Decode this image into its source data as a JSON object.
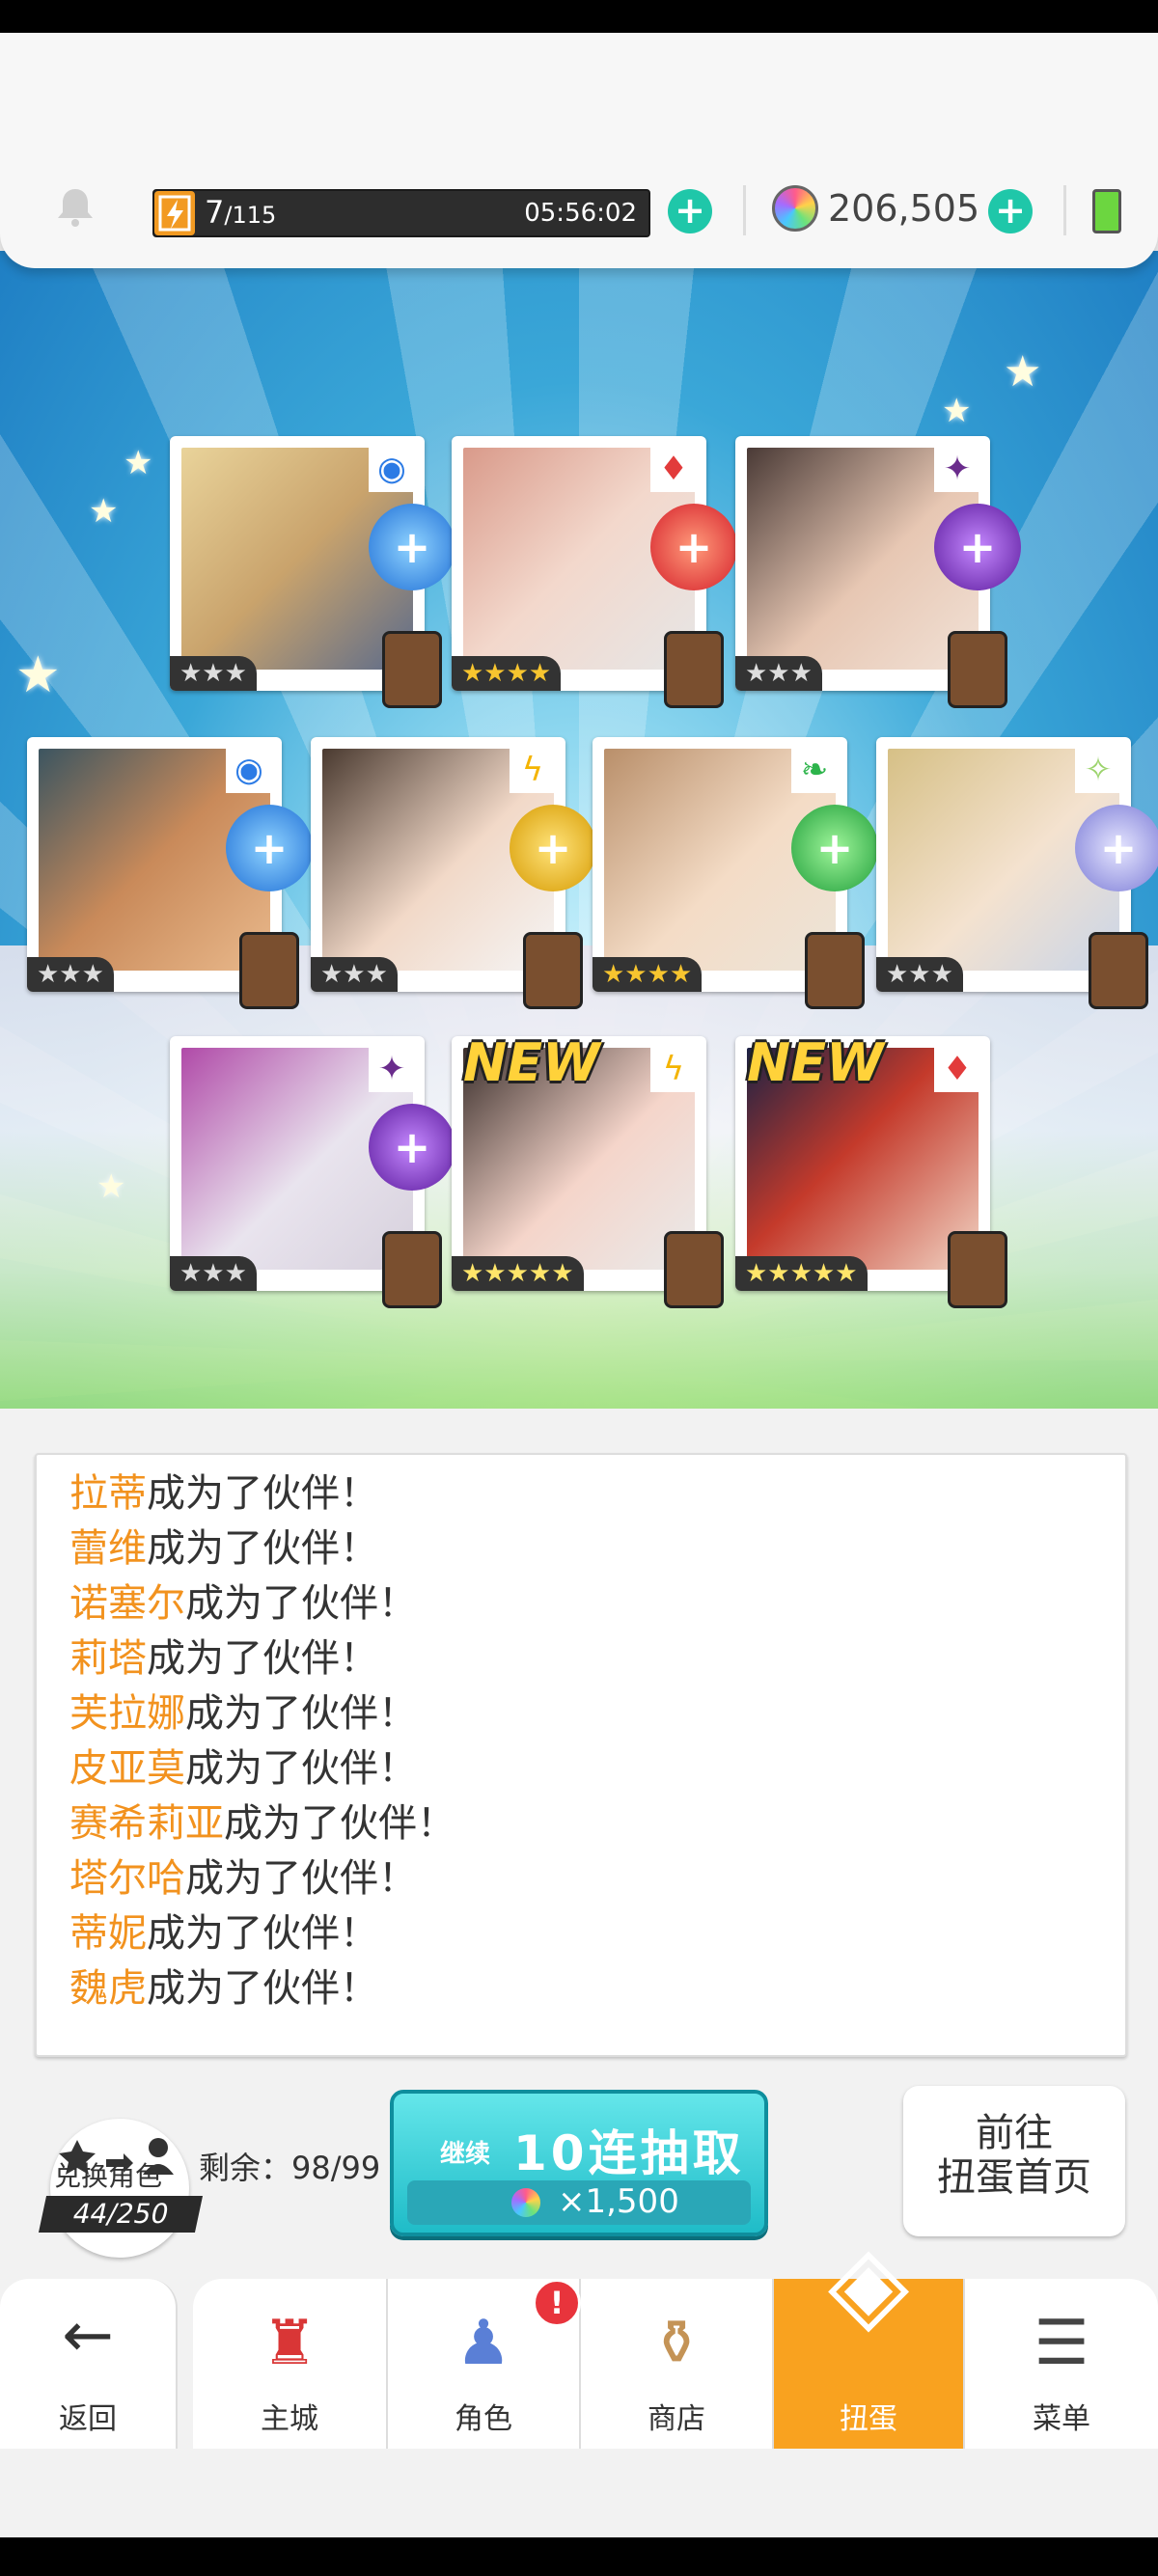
{
  "top_bar": {
    "stamina_current": "7",
    "stamina_max": "/115",
    "timer": "05:56:02",
    "gems": "206,505"
  },
  "cards": [
    {
      "stars": "★★★",
      "attr": "water",
      "new": ""
    },
    {
      "stars": "★★★★",
      "attr": "fire",
      "new": ""
    },
    {
      "stars": "★★★",
      "attr": "dark",
      "new": ""
    },
    {
      "stars": "★★★",
      "attr": "water",
      "new": ""
    },
    {
      "stars": "★★★",
      "attr": "thunder",
      "new": ""
    },
    {
      "stars": "★★★★",
      "attr": "wind",
      "new": ""
    },
    {
      "stars": "★★★",
      "attr": "light",
      "new": ""
    },
    {
      "stars": "★★★",
      "attr": "dark",
      "new": ""
    },
    {
      "stars": "★★★★★",
      "attr": "thunder",
      "new": "NEW"
    },
    {
      "stars": "★★★★★",
      "attr": "fire",
      "new": "NEW"
    }
  ],
  "log": [
    {
      "name": "拉蒂",
      "suffix": "成为了伙伴！"
    },
    {
      "name": "蕾维",
      "suffix": "成为了伙伴！"
    },
    {
      "name": "诺塞尔",
      "suffix": "成为了伙伴！"
    },
    {
      "name": "莉塔",
      "suffix": "成为了伙伴！"
    },
    {
      "name": "芙拉娜",
      "suffix": "成为了伙伴！"
    },
    {
      "name": "皮亚莫",
      "suffix": "成为了伙伴！"
    },
    {
      "name": "赛希莉亚",
      "suffix": "成为了伙伴！"
    },
    {
      "name": "塔尔哈",
      "suffix": "成为了伙伴！"
    },
    {
      "name": "蒂妮",
      "suffix": "成为了伙伴！"
    },
    {
      "name": "魏虎",
      "suffix": "成为了伙伴！"
    }
  ],
  "exchange": {
    "label": "兑换角色",
    "count": "44/250"
  },
  "remaining": "剩余：98/99",
  "draw_button": {
    "prefix": "继续",
    "label": "10连抽取",
    "cost": "×1,500"
  },
  "goto_button": {
    "line1": "前往",
    "line2": "扭蛋首页"
  },
  "nav": [
    {
      "label": "返回",
      "icon": "back-arrow-icon"
    },
    {
      "label": "主城",
      "icon": "castle-icon"
    },
    {
      "label": "角色",
      "icon": "character-icon"
    },
    {
      "label": "商店",
      "icon": "shop-icon"
    },
    {
      "label": "扭蛋",
      "icon": "gacha-icon"
    },
    {
      "label": "菜单",
      "icon": "menu-icon"
    }
  ],
  "colors": {
    "accent": "#f9a21f",
    "name_highlight": "#f2921e",
    "draw_button": "#1fbcc8",
    "plus_button": "#1fc7a9"
  }
}
